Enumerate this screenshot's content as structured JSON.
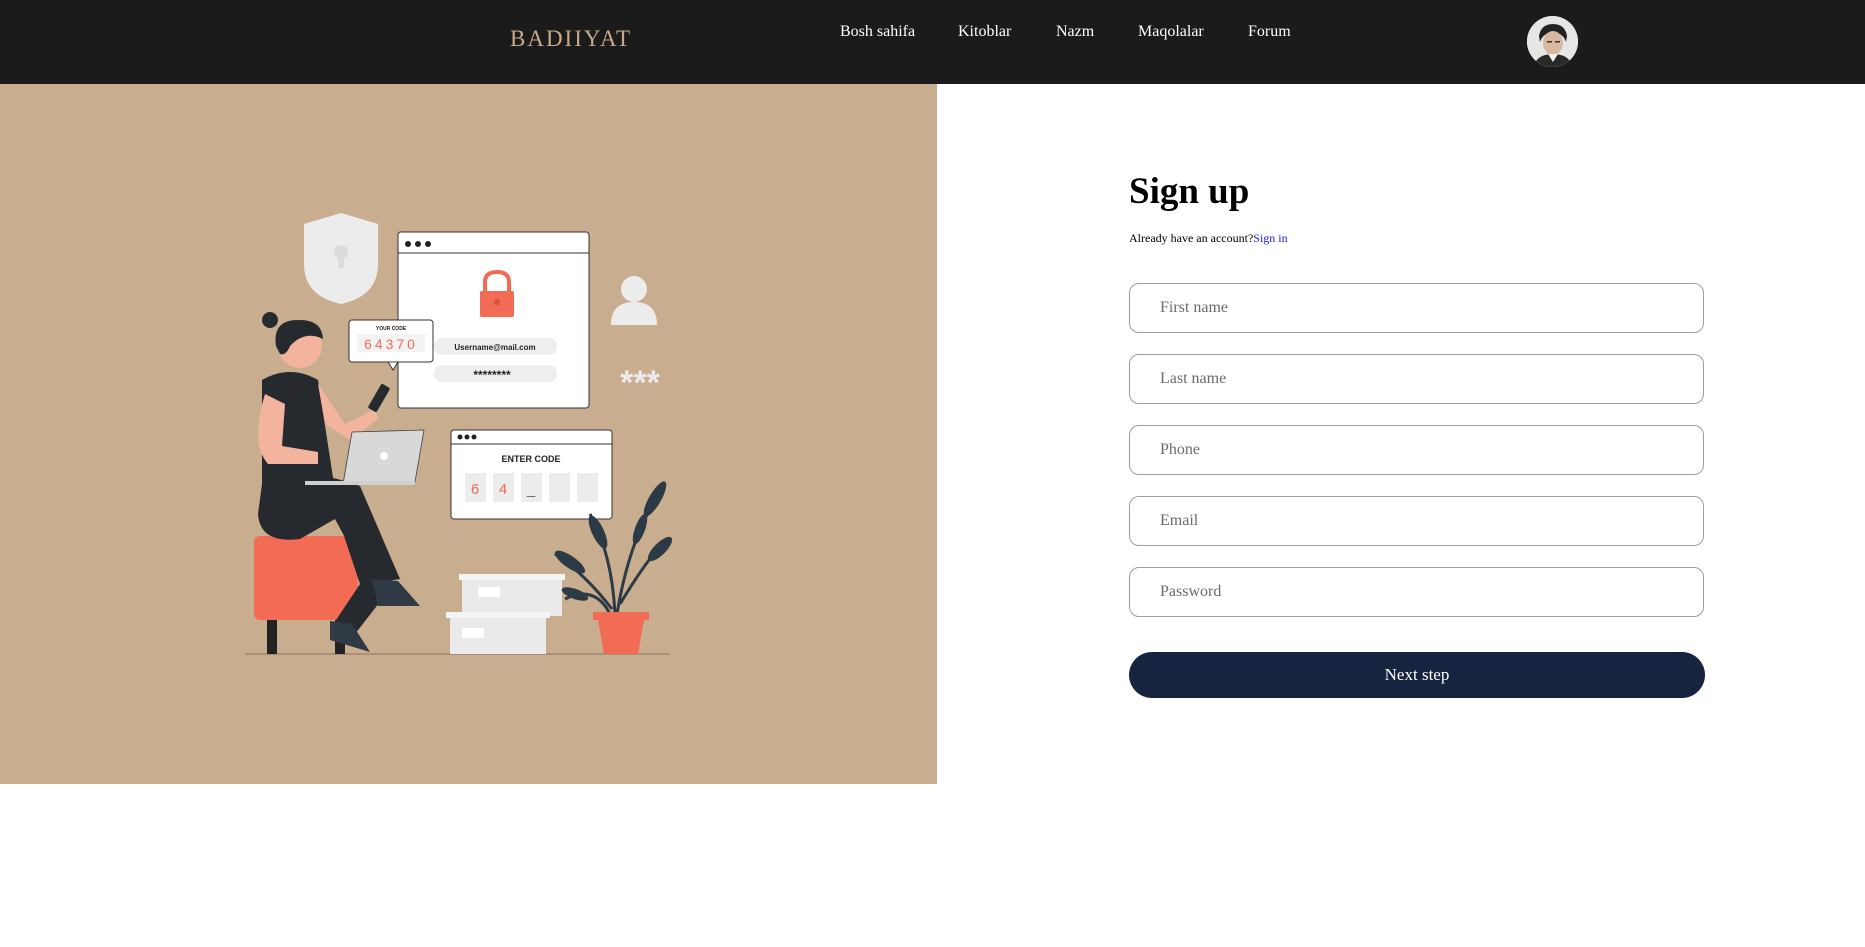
{
  "header": {
    "logo": "Badiiyat",
    "nav": [
      "Bosh sahifa",
      "Kitoblar",
      "Nazm",
      "Maqolalar",
      "Forum"
    ]
  },
  "illustration": {
    "your_code_label": "YOUR CODE",
    "your_code_value": "64370",
    "username": "Username@mail.com",
    "password_mask": "********",
    "asterisks": "***",
    "enter_code_label": "ENTER CODE",
    "entered_digits": [
      "6",
      "4",
      "_",
      "",
      ""
    ]
  },
  "form": {
    "title": "Sign up",
    "account_prompt": "Already have an account?",
    "signin_link": "Sign in",
    "fields": {
      "first_name": "First name",
      "last_name": "Last name",
      "phone": "Phone",
      "email": "Email",
      "password": "Password"
    },
    "submit": "Next step"
  },
  "colors": {
    "header_bg": "#1b1b1b",
    "panel_bg": "#c8ad8e",
    "accent": "#f26b55",
    "button_bg": "#17243f"
  }
}
